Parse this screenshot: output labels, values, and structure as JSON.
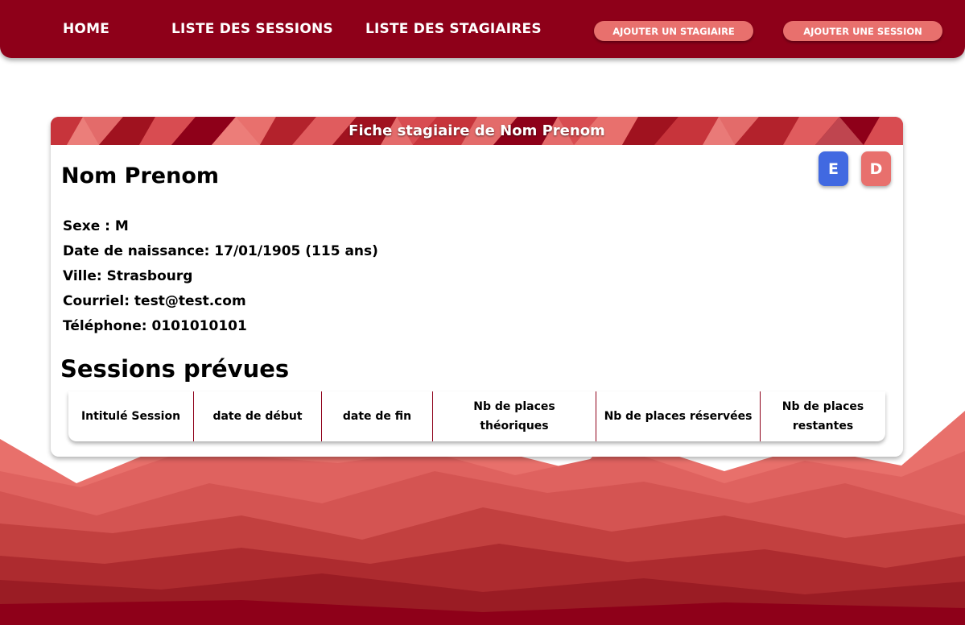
{
  "navbar": {
    "links": [
      {
        "label": "HOME"
      },
      {
        "label": "LISTE DES SESSIONS"
      },
      {
        "label": "LISTE DES STAGIAIRES"
      }
    ],
    "buttons": [
      {
        "label": "AJOUTER UN STAGIAIRE"
      },
      {
        "label": "AJOUTER UNE SESSION"
      }
    ]
  },
  "card": {
    "header_title": "Fiche stagiaire de Nom Prenom",
    "name": "Nom Prenom",
    "edit_button": "E",
    "delete_button": "D",
    "info": [
      "Sexe : M",
      "Date de naissance: 17/01/1905 (115 ans)",
      "Ville: Strasbourg",
      "Courriel: test@test.com",
      "Téléphone: 0101010101"
    ],
    "sessions_heading": "Sessions prévues",
    "table_headers": [
      "Intitulé Session",
      "date de début",
      "date de fin",
      "Nb de places théoriques",
      "Nb de places réservées",
      "Nb de places restantes"
    ]
  },
  "colors": {
    "brand": "#8e0019",
    "accent": "#e8706d",
    "edit": "#4169e1",
    "delete": "#e8706d"
  }
}
